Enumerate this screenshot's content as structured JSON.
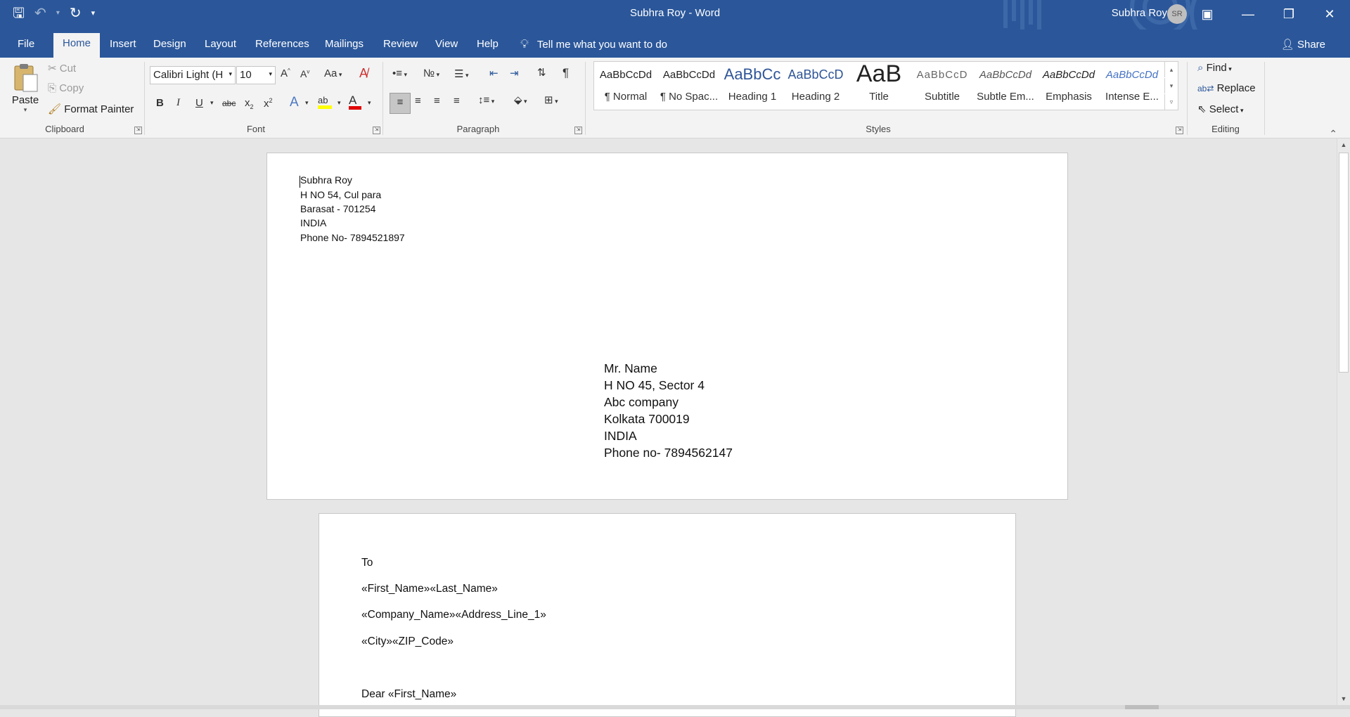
{
  "window": {
    "title": "Subhra Roy  -  Word",
    "user_name": "Subhra Roy",
    "user_initials": "SR",
    "share_label": "Share"
  },
  "tabs": [
    "File",
    "Home",
    "Insert",
    "Design",
    "Layout",
    "References",
    "Mailings",
    "Review",
    "View",
    "Help"
  ],
  "tell_me": "Tell me what you want to do",
  "clipboard": {
    "paste": "Paste",
    "cut": "Cut",
    "copy": "Copy",
    "format_painter": "Format Painter",
    "group_label": "Clipboard"
  },
  "font": {
    "name": "Calibri Light (H",
    "size": "10",
    "change_case": "Aa",
    "group_label": "Font"
  },
  "paragraph": {
    "group_label": "Paragraph"
  },
  "styles": {
    "group_label": "Styles",
    "items": [
      {
        "preview": "AaBbCcDd",
        "label": "¶ Normal"
      },
      {
        "preview": "AaBbCcDd",
        "label": "¶ No Spac..."
      },
      {
        "preview": "AaBbCc",
        "label": "Heading 1"
      },
      {
        "preview": "AaBbCcD",
        "label": "Heading 2"
      },
      {
        "preview": "AaB",
        "label": "Title"
      },
      {
        "preview": "AaBbCcD",
        "label": "Subtitle"
      },
      {
        "preview": "AaBbCcDd",
        "label": "Subtle Em..."
      },
      {
        "preview": "AaBbCcDd",
        "label": "Emphasis"
      },
      {
        "preview": "AaBbCcDd",
        "label": "Intense E..."
      }
    ]
  },
  "editing": {
    "find": "Find",
    "replace": "Replace",
    "select": "Select",
    "group_label": "Editing"
  },
  "document": {
    "sender": [
      "Subhra Roy",
      "H NO 54, Cul para",
      "Barasat - 701254",
      "INDIA",
      "Phone No- 7894521897"
    ],
    "recipient": [
      "Mr. Name",
      "H NO 45, Sector 4",
      "Abc company",
      "Kolkata 700019",
      "INDIA",
      "Phone no- 7894562147"
    ],
    "merge": {
      "to": "To",
      "name_fields": "«First_Name»«Last_Name»",
      "company_fields": "«Company_Name»«Address_Line_1»",
      "city_fields": "«City»«ZIP_Code»",
      "greeting": "Dear «First_Name»"
    }
  },
  "colors": {
    "titlebar": "#2b579a",
    "ribbon": "#f3f3f3",
    "workspace": "#e6e6e6",
    "accent_text": "#2b579a",
    "highlight": "#ffff00",
    "font_color": "#e00000"
  }
}
